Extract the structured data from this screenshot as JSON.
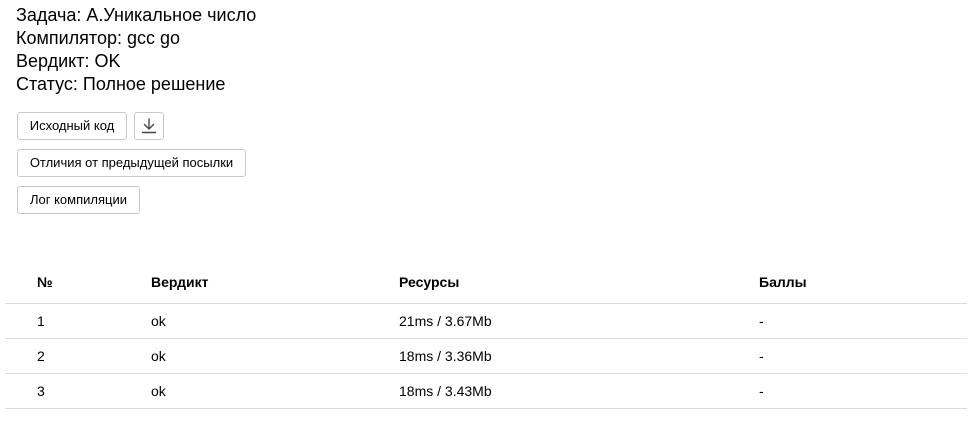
{
  "submission": {
    "task": "Задача: А.Уникальное число",
    "compiler": "Компилятор: gcc go",
    "verdict": "Вердикт: OK",
    "status": "Статус: Полное решение"
  },
  "buttons": {
    "source_code": "Исходный код",
    "download_icon": "download-icon",
    "diff": "Отличия от предыдущей посылки",
    "compile_log": "Лог компиляции"
  },
  "results": {
    "headers": {
      "number": "№",
      "verdict": "Вердикт",
      "resources": "Ресурсы",
      "points": "Баллы"
    },
    "rows": [
      {
        "number": "1",
        "verdict": "ok",
        "resources": "21ms / 3.67Mb",
        "points": "-"
      },
      {
        "number": "2",
        "verdict": "ok",
        "resources": "18ms / 3.36Mb",
        "points": "-"
      },
      {
        "number": "3",
        "verdict": "ok",
        "resources": "18ms / 3.43Mb",
        "points": "-"
      }
    ]
  },
  "colors": {
    "border": "#c9c9c9",
    "divider": "#dcdcdc",
    "text": "#000000"
  }
}
